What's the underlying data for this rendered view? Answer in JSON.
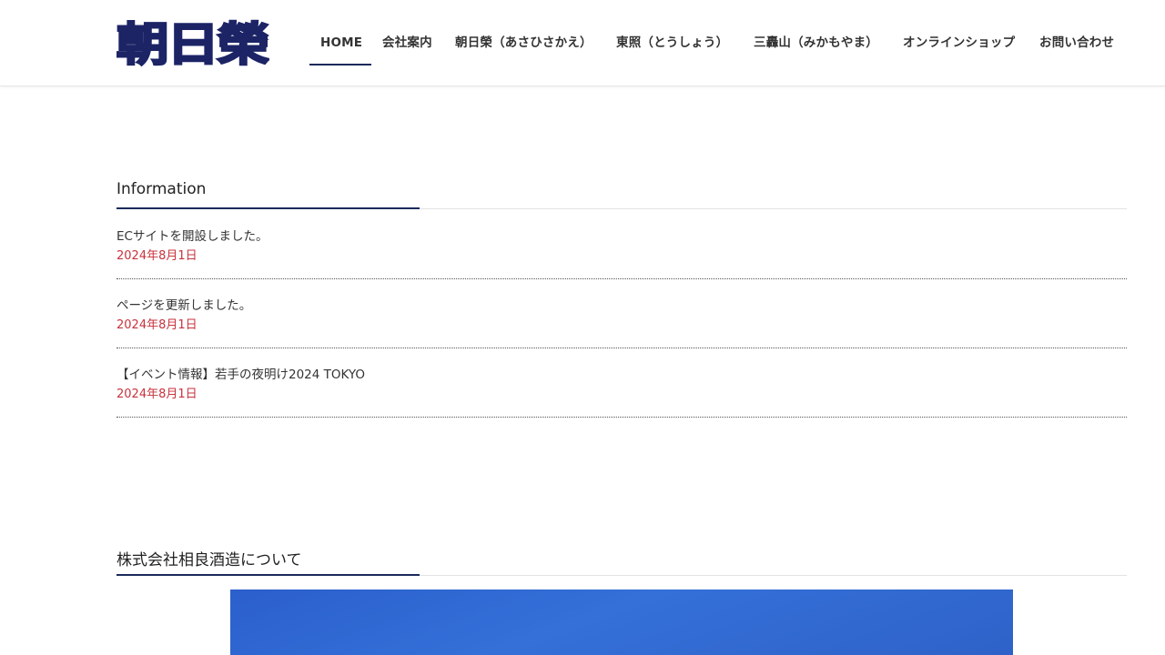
{
  "header": {
    "logo_text": "朝日榮",
    "nav": [
      {
        "label": "HOME",
        "active": true
      },
      {
        "label": "会社案内"
      },
      {
        "label": "朝日榮（あさひさかえ）"
      },
      {
        "label": "東照（とうしょう）"
      },
      {
        "label": "三轟山（みかもやま）"
      },
      {
        "label": "オンラインショップ"
      },
      {
        "label": "お問い合わせ"
      }
    ]
  },
  "information": {
    "title": "Information",
    "items": [
      {
        "text": "ECサイトを開設しました。",
        "date": "2024年8月1日"
      },
      {
        "text": "ページを更新しました。",
        "date": "2024年8月1日"
      },
      {
        "text": "【イベント情報】若手の夜明け2024 TOKYO",
        "date": "2024年8月1日"
      }
    ]
  },
  "about": {
    "title": "株式会社相良酒造について"
  },
  "colors": {
    "navy": "#1a2a5a",
    "date_red": "#c8323c",
    "hero_blue": "#3470d8"
  }
}
